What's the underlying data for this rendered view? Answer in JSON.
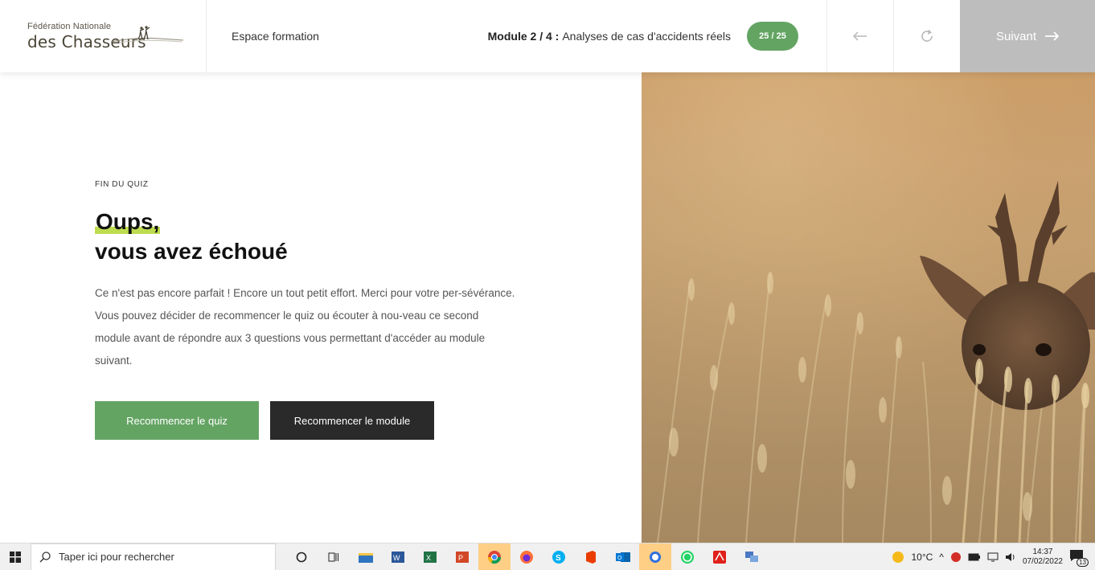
{
  "header": {
    "logo_small": "Fédération Nationale",
    "logo_big": "des Chasseurs",
    "espace": "Espace formation",
    "module_bold": "Module 2 / 4 :",
    "module_title": "Analyses de cas d'accidents réels",
    "progress": "25 / 25",
    "next_label": "Suivant",
    "accent": "#64a463"
  },
  "main": {
    "eyebrow": "FIN DU QUIZ",
    "headline_1": "Oups,",
    "headline_2": "vous avez échoué",
    "body": "Ce n'est pas encore parfait ! Encore un tout petit effort. Merci pour votre per-sévérance. Vous pouvez décider de recommencer le quiz ou écouter à nou-veau ce second module avant de répondre aux 3 questions vous permettant d'accéder au module suivant.",
    "btn_quiz": "Recommencer le quiz",
    "btn_module": "Recommencer le module"
  },
  "taskbar": {
    "search_placeholder": "Taper ici pour rechercher",
    "temperature": "10°C",
    "time": "14:37",
    "date": "07/02/2022",
    "notifications": "13"
  }
}
